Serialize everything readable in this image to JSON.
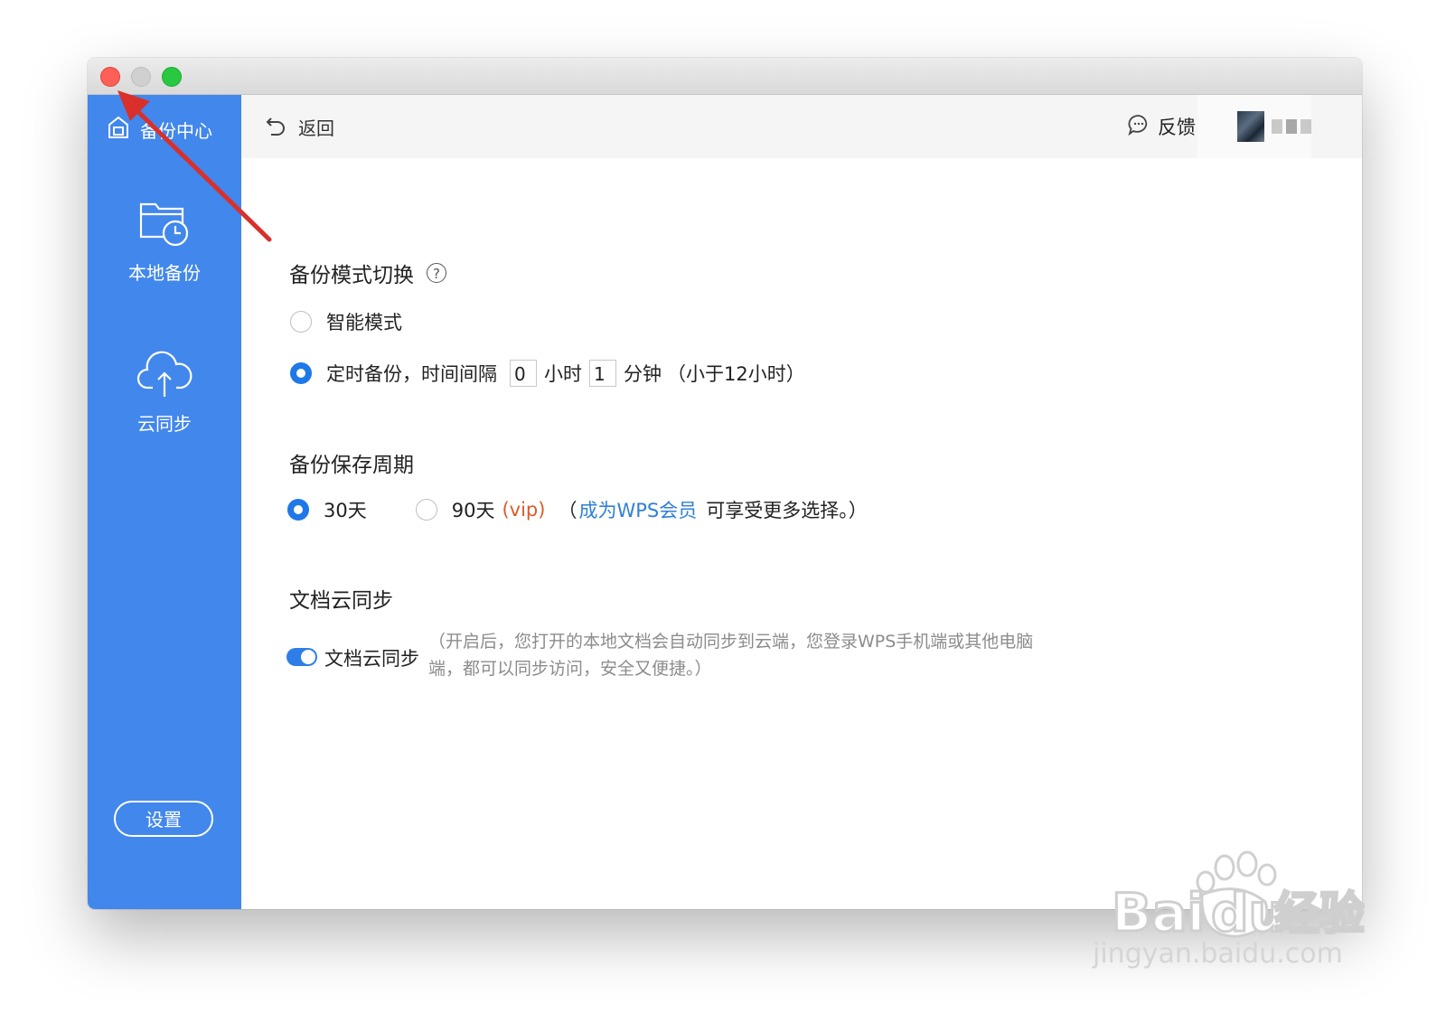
{
  "sidebar": {
    "brand": "备份中心",
    "items": [
      {
        "label": "本地备份",
        "icon": "folder-clock-icon"
      },
      {
        "label": "云同步",
        "icon": "cloud-upload-icon"
      }
    ],
    "settings_label": "设置",
    "color": "#4287ec"
  },
  "topbar": {
    "back_label": "返回",
    "feedback_label": "反馈"
  },
  "backup_mode": {
    "title": "备份模式切换",
    "smart_label": "智能模式",
    "scheduled_label": "定时备份，时间间隔",
    "hours_value": "0",
    "hours_unit": "小时",
    "minutes_value": "1",
    "minutes_unit": "分钟",
    "limit_note": "（小于12小时）",
    "selected": "scheduled"
  },
  "retention": {
    "title": "备份保存周期",
    "opt30_label": "30天",
    "opt90_label": "90天",
    "vip_label": "(vip)",
    "paren_open": "（",
    "member_link": "成为WPS会员",
    "more_text": "可享受更多选择。）",
    "selected": "30"
  },
  "doc_sync": {
    "title": "文档云同步",
    "toggle_label": "文档云同步",
    "enabled": true,
    "description": "（开启后，您打开的本地文档会自动同步到云端，您登录WPS手机端或其他电脑端，都可以同步访问，安全又便捷。）"
  },
  "watermark": {
    "text": "jingyan.baidu.com"
  },
  "accent_color": "#1f78e8"
}
